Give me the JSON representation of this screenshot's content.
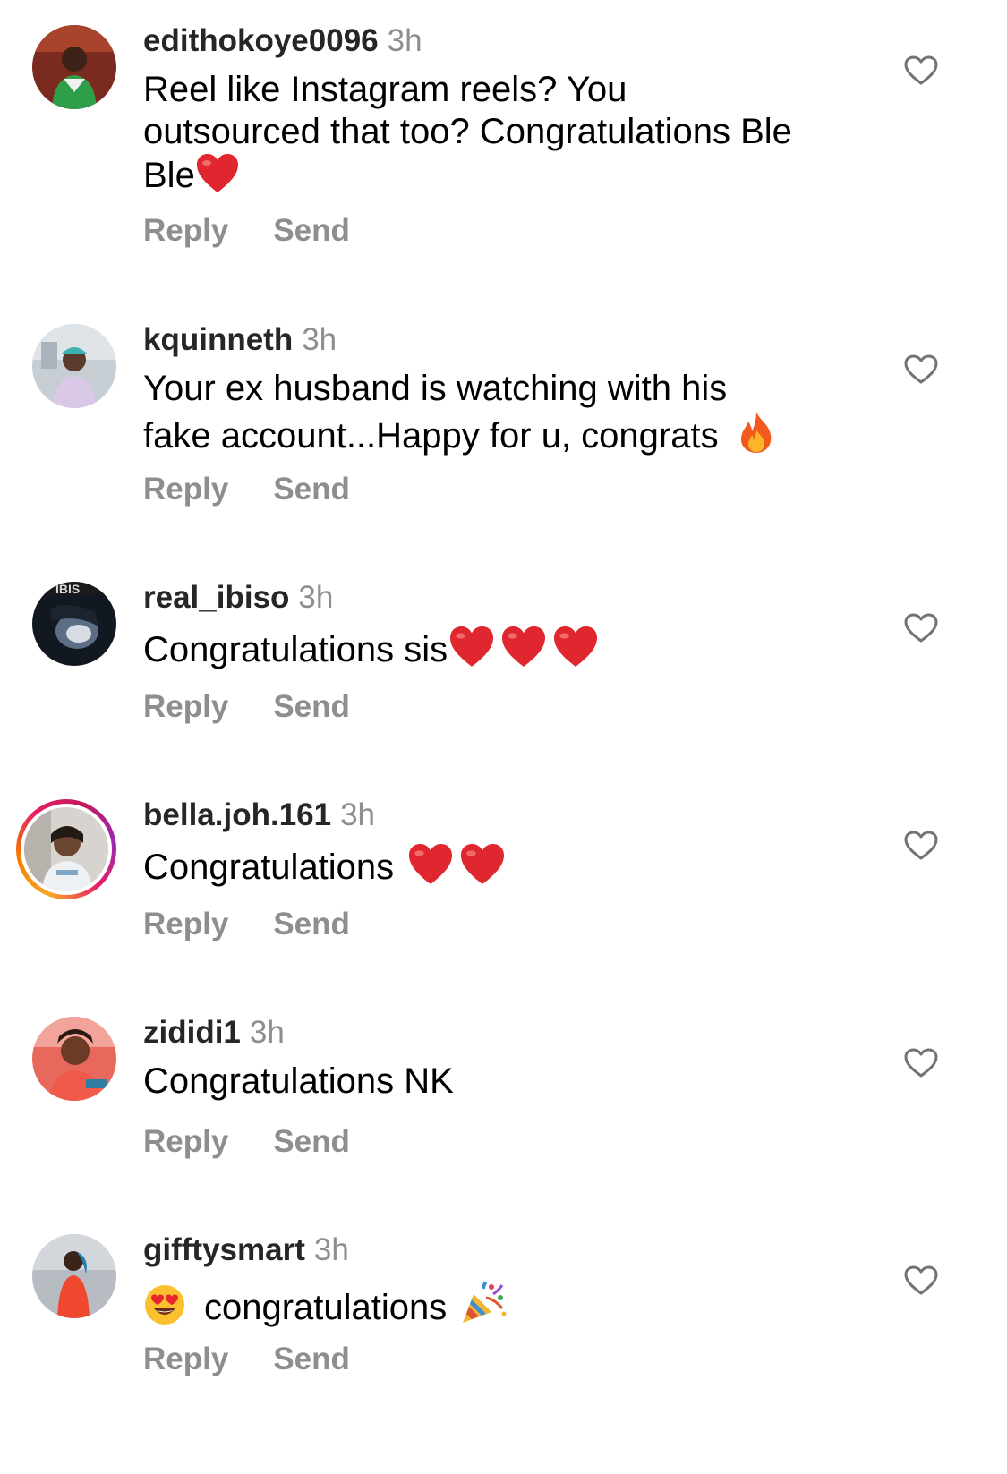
{
  "colors": {
    "username": "#262626",
    "secondary": "#8e8e8e",
    "text": "#000000",
    "heart": "#e0262f"
  },
  "comments": [
    {
      "username": "edithokoye0096",
      "time": "3h",
      "text_lines": [
        "Reel like Instagram reels? You",
        "outsourced that too? Congratulations Ble",
        "Ble"
      ],
      "emojis": [
        "red-heart"
      ],
      "reply_label": "Reply",
      "send_label": "Send",
      "has_story_ring": false
    },
    {
      "username": "kquinneth",
      "time": "3h",
      "text_lines": [
        "Your ex husband is watching with his",
        "fake account...Happy for u, congrats"
      ],
      "emojis": [
        "fire"
      ],
      "reply_label": "Reply",
      "send_label": "Send",
      "has_story_ring": false
    },
    {
      "username": "real_ibiso",
      "time": "3h",
      "text_lines": [
        "Congratulations sis"
      ],
      "emojis": [
        "red-heart",
        "red-heart",
        "red-heart"
      ],
      "avatar_text": "IBIS",
      "reply_label": "Reply",
      "send_label": "Send",
      "has_story_ring": false
    },
    {
      "username": "bella.joh.161",
      "time": "3h",
      "text_lines": [
        "Congratulations"
      ],
      "emojis": [
        "red-heart",
        "red-heart"
      ],
      "reply_label": "Reply",
      "send_label": "Send",
      "has_story_ring": true
    },
    {
      "username": "zididi1",
      "time": "3h",
      "text_lines": [
        "Congratulations NK"
      ],
      "emojis": [],
      "reply_label": "Reply",
      "send_label": "Send",
      "has_story_ring": false
    },
    {
      "username": "gifftysmart",
      "time": "3h",
      "text_lines": [
        "congratulations"
      ],
      "emojis": [
        "heart-eyes",
        "party-popper"
      ],
      "reply_label": "Reply",
      "send_label": "Send",
      "has_story_ring": false
    }
  ]
}
